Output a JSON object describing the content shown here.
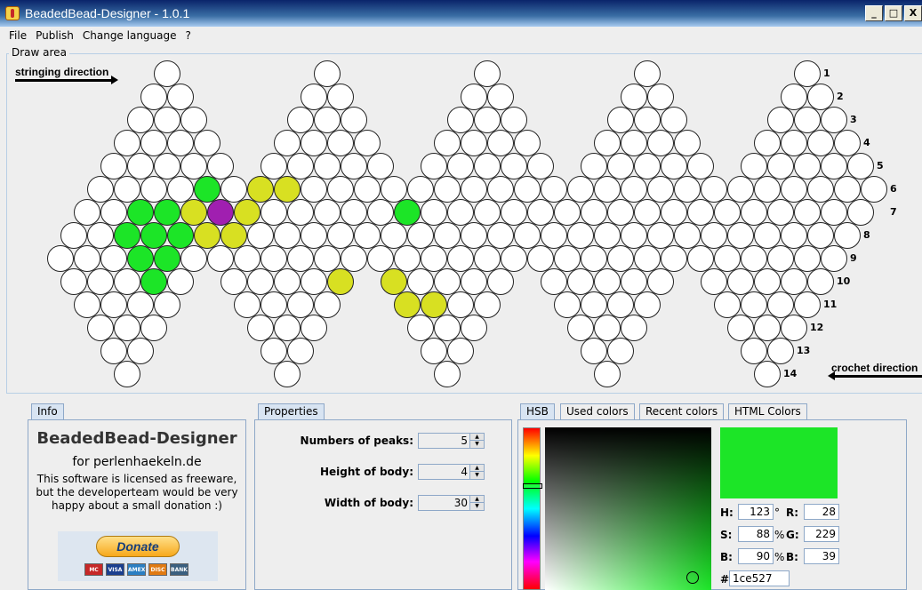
{
  "window": {
    "title": "BeadedBead-Designer - 1.0.1",
    "minimize": "_",
    "maximize": "□",
    "close": "X"
  },
  "menu": [
    "File",
    "Publish",
    "Change language",
    "?"
  ],
  "draw_area": {
    "label": "Draw area",
    "stringing_direction": "stringing direction",
    "crochet_direction": "crochet direction",
    "row_numbers": [
      "1",
      "2",
      "3",
      "4",
      "5",
      "6",
      "7",
      "8",
      "9",
      "10",
      "11",
      "12",
      "13",
      "14"
    ],
    "colored_beads": [
      {
        "row": 6,
        "index": 4,
        "color": "#1ce527"
      },
      {
        "row": 6,
        "index": 6,
        "color": "#d8e022"
      },
      {
        "row": 6,
        "index": 7,
        "color": "#d8e022"
      },
      {
        "row": 7,
        "index": 2,
        "color": "#1ce527"
      },
      {
        "row": 7,
        "index": 3,
        "color": "#1ce527"
      },
      {
        "row": 7,
        "index": 4,
        "color": "#d8e022"
      },
      {
        "row": 7,
        "index": 5,
        "color": "#a01fb0"
      },
      {
        "row": 7,
        "index": 6,
        "color": "#d8e022"
      },
      {
        "row": 7,
        "index": 12,
        "color": "#1ce527"
      },
      {
        "row": 8,
        "index": 2,
        "color": "#1ce527"
      },
      {
        "row": 8,
        "index": 3,
        "color": "#1ce527"
      },
      {
        "row": 8,
        "index": 4,
        "color": "#1ce527"
      },
      {
        "row": 8,
        "index": 5,
        "color": "#d8e022"
      },
      {
        "row": 8,
        "index": 6,
        "color": "#d8e022"
      },
      {
        "row": 9,
        "index": 3,
        "color": "#1ce527"
      },
      {
        "row": 9,
        "index": 4,
        "color": "#1ce527"
      },
      {
        "row": 10,
        "index": 3,
        "color": "#1ce527"
      },
      {
        "row": 10,
        "index": 9,
        "color": "#d8e022"
      },
      {
        "row": 10,
        "index": 10,
        "color": "#d8e022"
      },
      {
        "row": 11,
        "index": 8,
        "color": "#d8e022"
      },
      {
        "row": 11,
        "index": 9,
        "color": "#d8e022"
      }
    ]
  },
  "info": {
    "tab": "Info",
    "title": "BeadedBead-Designer",
    "subtitle": "for perlenhaekeln.de",
    "text": "This software is licensed as freeware, but the developerteam would be very happy about a small donation :)",
    "donate": "Donate",
    "cards": [
      "MC",
      "VISA",
      "AMEX",
      "DISC",
      "BANK"
    ]
  },
  "properties": {
    "tab": "Properties",
    "peaks_label": "Numbers of peaks:",
    "peaks": "5",
    "height_label": "Height of body:",
    "height": "4",
    "width_label": "Width of body:",
    "width": "30"
  },
  "color_chooser": {
    "tabs": [
      "HSB",
      "Used colors",
      "Recent colors",
      "HTML Colors"
    ],
    "h_label": "H:",
    "h": "123",
    "h_unit": "°",
    "s_label": "S:",
    "s": "88",
    "s_unit": "%",
    "b_label": "B:",
    "b": "90",
    "b_unit": "%",
    "r_label": "R:",
    "r": "28",
    "g_label": "G:",
    "g": "229",
    "bl_label": "B:",
    "bl": "39",
    "hex_label": "#",
    "hex": "1ce527",
    "selected_color": "#1ce527"
  }
}
